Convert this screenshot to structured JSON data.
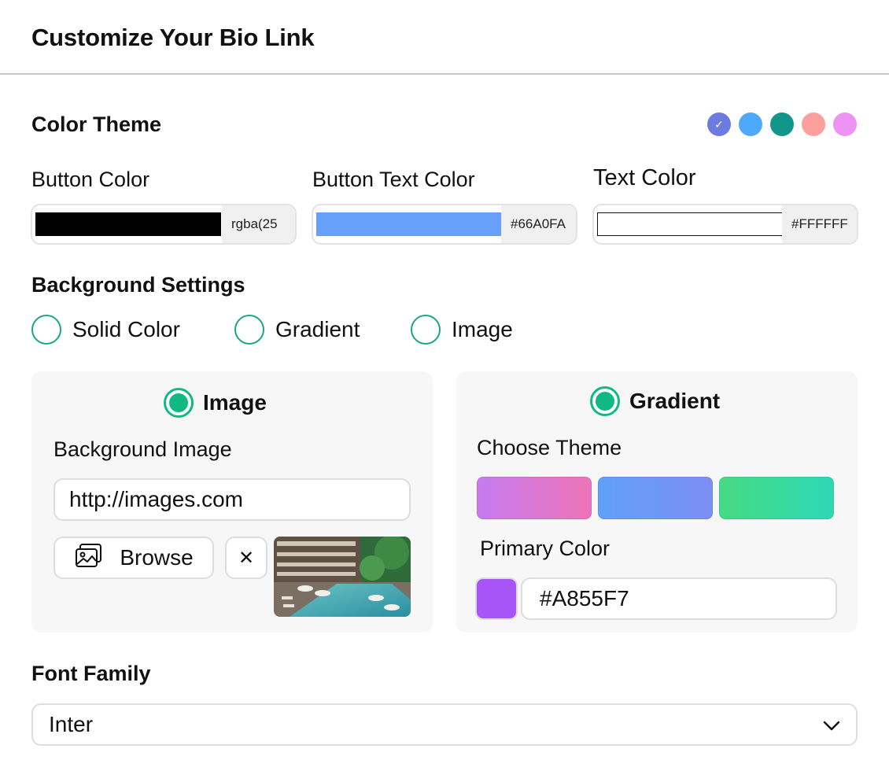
{
  "header": {
    "title": "Customize Your Bio Link"
  },
  "color_theme": {
    "title": "Color Theme",
    "swatches": [
      {
        "color": "#6B7BE0",
        "selected": true,
        "check_icon": "check-icon"
      },
      {
        "color": "#4FA9FB",
        "selected": false
      },
      {
        "color": "#13968A",
        "selected": false
      },
      {
        "color": "#FCA09D",
        "selected": false
      },
      {
        "color": "#EE93F4",
        "selected": false
      }
    ],
    "check_glyph": "✓"
  },
  "colors": {
    "button_color": {
      "label": "Button Color",
      "value": "rgba(25",
      "swatch": "#000000"
    },
    "button_text_color": {
      "label": "Button Text Color",
      "value": "#66A0FA",
      "swatch": "#66A0FA"
    },
    "text_color": {
      "label": "Text Color",
      "value": "#FFFFFF",
      "swatch": "#FFFFFF"
    }
  },
  "background": {
    "title": "Background Settings",
    "options": [
      "Solid Color",
      "Gradient",
      "Image"
    ]
  },
  "image_card": {
    "heading": "Image",
    "field_label": "Background Image",
    "url_value": "http://images.com",
    "browse_label": "Browse",
    "browse_icon": "images-icon",
    "clear_glyph": "✕"
  },
  "gradient_card": {
    "heading": "Gradient",
    "theme_label": "Choose Theme",
    "themes": [
      {
        "from": "#C57BF0",
        "to": "#EE74B6"
      },
      {
        "from": "#5FA0F8",
        "to": "#7D8EF3"
      },
      {
        "from": "#46DB82",
        "to": "#2ED7B7"
      }
    ],
    "primary_label": "Primary Color",
    "primary_value": "#A855F7",
    "primary_swatch": "#A855F7"
  },
  "font": {
    "label": "Font Family",
    "selected": "Inter",
    "chevron_glyph": "⌄"
  }
}
